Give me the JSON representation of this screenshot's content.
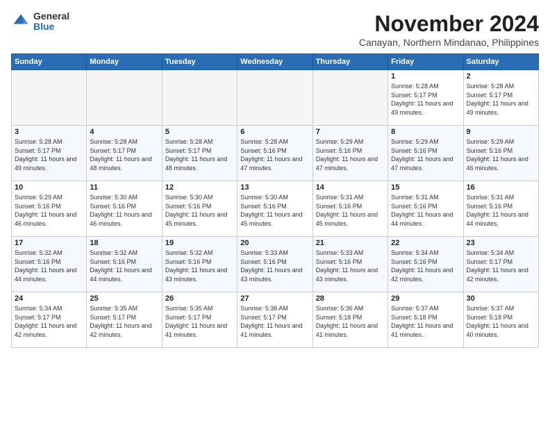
{
  "logo": {
    "general": "General",
    "blue": "Blue"
  },
  "title": "November 2024",
  "location": "Canayan, Northern Mindanao, Philippines",
  "days_of_week": [
    "Sunday",
    "Monday",
    "Tuesday",
    "Wednesday",
    "Thursday",
    "Friday",
    "Saturday"
  ],
  "weeks": [
    [
      {
        "day": "",
        "info": ""
      },
      {
        "day": "",
        "info": ""
      },
      {
        "day": "",
        "info": ""
      },
      {
        "day": "",
        "info": ""
      },
      {
        "day": "",
        "info": ""
      },
      {
        "day": "1",
        "info": "Sunrise: 5:28 AM\nSunset: 5:17 PM\nDaylight: 11 hours and 49 minutes."
      },
      {
        "day": "2",
        "info": "Sunrise: 5:28 AM\nSunset: 5:17 PM\nDaylight: 11 hours and 49 minutes."
      }
    ],
    [
      {
        "day": "3",
        "info": "Sunrise: 5:28 AM\nSunset: 5:17 PM\nDaylight: 11 hours and 49 minutes."
      },
      {
        "day": "4",
        "info": "Sunrise: 5:28 AM\nSunset: 5:17 PM\nDaylight: 11 hours and 48 minutes."
      },
      {
        "day": "5",
        "info": "Sunrise: 5:28 AM\nSunset: 5:17 PM\nDaylight: 11 hours and 48 minutes."
      },
      {
        "day": "6",
        "info": "Sunrise: 5:28 AM\nSunset: 5:16 PM\nDaylight: 11 hours and 47 minutes."
      },
      {
        "day": "7",
        "info": "Sunrise: 5:29 AM\nSunset: 5:16 PM\nDaylight: 11 hours and 47 minutes."
      },
      {
        "day": "8",
        "info": "Sunrise: 5:29 AM\nSunset: 5:16 PM\nDaylight: 11 hours and 47 minutes."
      },
      {
        "day": "9",
        "info": "Sunrise: 5:29 AM\nSunset: 5:16 PM\nDaylight: 11 hours and 46 minutes."
      }
    ],
    [
      {
        "day": "10",
        "info": "Sunrise: 5:29 AM\nSunset: 5:16 PM\nDaylight: 11 hours and 46 minutes."
      },
      {
        "day": "11",
        "info": "Sunrise: 5:30 AM\nSunset: 5:16 PM\nDaylight: 11 hours and 46 minutes."
      },
      {
        "day": "12",
        "info": "Sunrise: 5:30 AM\nSunset: 5:16 PM\nDaylight: 11 hours and 45 minutes."
      },
      {
        "day": "13",
        "info": "Sunrise: 5:30 AM\nSunset: 5:16 PM\nDaylight: 11 hours and 45 minutes."
      },
      {
        "day": "14",
        "info": "Sunrise: 5:31 AM\nSunset: 5:16 PM\nDaylight: 11 hours and 45 minutes."
      },
      {
        "day": "15",
        "info": "Sunrise: 5:31 AM\nSunset: 5:16 PM\nDaylight: 11 hours and 44 minutes."
      },
      {
        "day": "16",
        "info": "Sunrise: 5:31 AM\nSunset: 5:16 PM\nDaylight: 11 hours and 44 minutes."
      }
    ],
    [
      {
        "day": "17",
        "info": "Sunrise: 5:32 AM\nSunset: 5:16 PM\nDaylight: 11 hours and 44 minutes."
      },
      {
        "day": "18",
        "info": "Sunrise: 5:32 AM\nSunset: 5:16 PM\nDaylight: 11 hours and 44 minutes."
      },
      {
        "day": "19",
        "info": "Sunrise: 5:32 AM\nSunset: 5:16 PM\nDaylight: 11 hours and 43 minutes."
      },
      {
        "day": "20",
        "info": "Sunrise: 5:33 AM\nSunset: 5:16 PM\nDaylight: 11 hours and 43 minutes."
      },
      {
        "day": "21",
        "info": "Sunrise: 5:33 AM\nSunset: 5:16 PM\nDaylight: 11 hours and 43 minutes."
      },
      {
        "day": "22",
        "info": "Sunrise: 5:34 AM\nSunset: 5:16 PM\nDaylight: 11 hours and 42 minutes."
      },
      {
        "day": "23",
        "info": "Sunrise: 5:34 AM\nSunset: 5:17 PM\nDaylight: 11 hours and 42 minutes."
      }
    ],
    [
      {
        "day": "24",
        "info": "Sunrise: 5:34 AM\nSunset: 5:17 PM\nDaylight: 11 hours and 42 minutes."
      },
      {
        "day": "25",
        "info": "Sunrise: 5:35 AM\nSunset: 5:17 PM\nDaylight: 11 hours and 42 minutes."
      },
      {
        "day": "26",
        "info": "Sunrise: 5:35 AM\nSunset: 5:17 PM\nDaylight: 11 hours and 41 minutes."
      },
      {
        "day": "27",
        "info": "Sunrise: 5:36 AM\nSunset: 5:17 PM\nDaylight: 11 hours and 41 minutes."
      },
      {
        "day": "28",
        "info": "Sunrise: 5:36 AM\nSunset: 5:18 PM\nDaylight: 11 hours and 41 minutes."
      },
      {
        "day": "29",
        "info": "Sunrise: 5:37 AM\nSunset: 5:18 PM\nDaylight: 11 hours and 41 minutes."
      },
      {
        "day": "30",
        "info": "Sunrise: 5:37 AM\nSunset: 5:18 PM\nDaylight: 11 hours and 40 minutes."
      }
    ]
  ]
}
